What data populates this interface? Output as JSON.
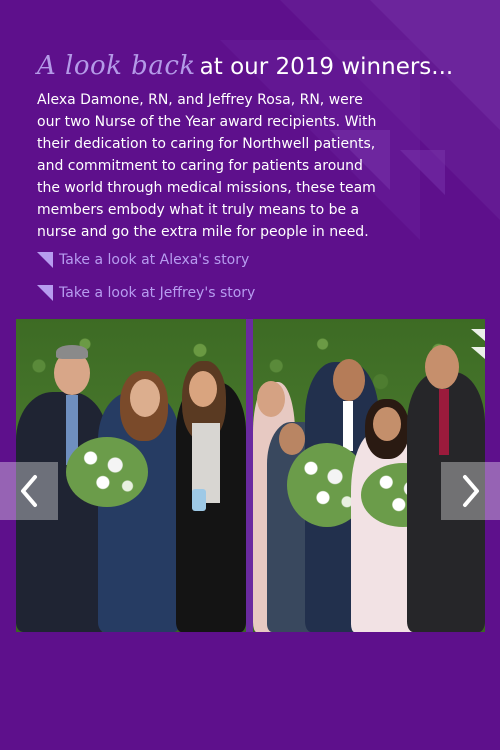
{
  "headline": {
    "script_text": "A look back",
    "rest_text": "at our 2019 winners..."
  },
  "body_text": "Alexa Damone, RN, and Jeffrey Rosa, RN, were our two Nurse of the Year award recipients. With their dedication to caring for Northwell patients, and commitment to caring for patients around the world through medical missions, these team members embody what it truly means to be a nurse and go the extra mile for people in need.",
  "links": {
    "alexa": "Take a look at Alexa's story",
    "jeffrey": "Take a look at Jeffrey's story"
  },
  "carousel": {
    "prev_icon": "chevron-left-icon",
    "next_icon": "chevron-right-icon"
  },
  "colors": {
    "background": "#5e108c",
    "accent": "#b79cf0",
    "text": "#ffffff"
  }
}
